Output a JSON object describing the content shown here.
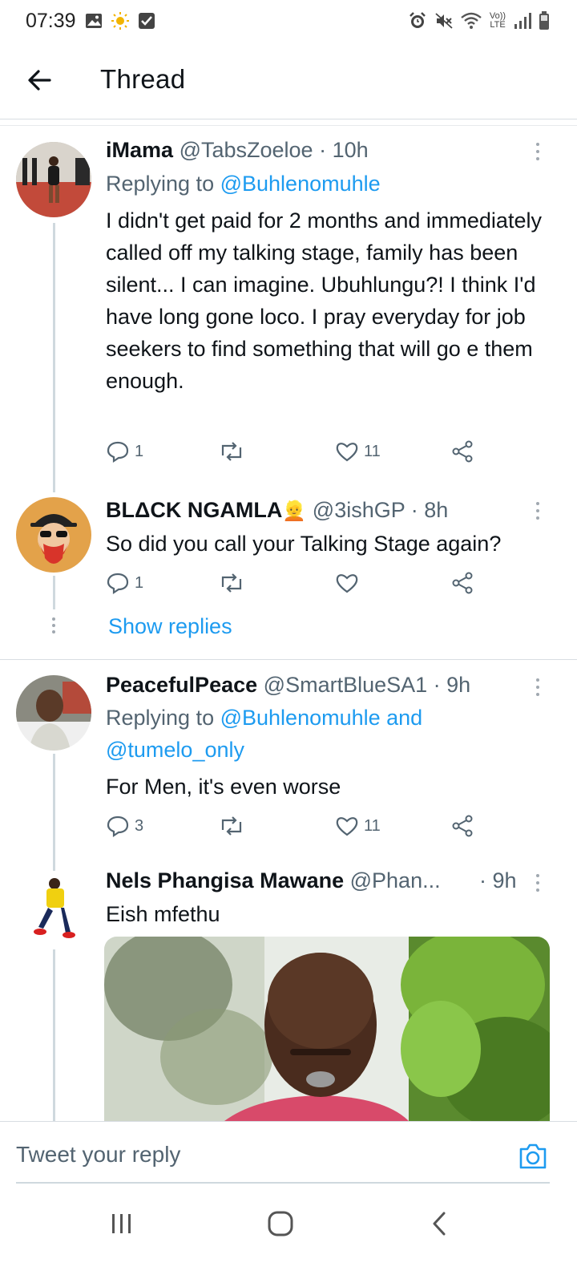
{
  "status_bar": {
    "time": "07:39",
    "left_icons": [
      "image-icon",
      "sun-icon",
      "checkbox-icon"
    ],
    "right_icons": [
      "alarm-icon",
      "mute-icon",
      "wifi-icon",
      "volte-icon",
      "signal-icon",
      "battery-icon"
    ],
    "volte_text": "Vo)) LTE"
  },
  "header": {
    "title": "Thread"
  },
  "tweets": [
    {
      "name": "iMama",
      "handle": "@TabsZoeloe",
      "time": "· 10h",
      "replying_prefix": "Replying to",
      "replying_to": "@Buhlenomuhle",
      "text": "I didn't get paid for 2 months and immediately called off my talking stage, family has been silent... I can imagine. Ubuhlungu?! I think I'd have long gone loco. I pray everyday for job seekers to find something that will go e them enough.",
      "replies": "1",
      "retweets": "",
      "likes": "11"
    },
    {
      "name": "BLΔCK NGAMLA",
      "emoji": "👱",
      "handle": "@3ishGP",
      "time": "· 8h",
      "text": "So did you call your Talking Stage again?",
      "replies": "1",
      "retweets": "",
      "likes": ""
    },
    {
      "name": "PeacefulPeace",
      "handle": "@SmartBlueSA1",
      "time": "· 9h",
      "replying_prefix": "Replying to",
      "replying_to": "@Buhlenomuhle and",
      "replying_to_2": "@tumelo_only",
      "text": "For Men, it's even worse",
      "replies": "3",
      "retweets": "",
      "likes": "11"
    },
    {
      "name": "Nels Phangisa Mawane",
      "handle": "@Phan...",
      "time": "· 9h",
      "text": "Eish mfethu"
    }
  ],
  "show_replies_label": "Show replies",
  "reply_bar": {
    "placeholder": "Tweet your reply"
  },
  "colors": {
    "accent": "#1d9bf0",
    "text": "#0f1419",
    "muted": "#536471"
  }
}
